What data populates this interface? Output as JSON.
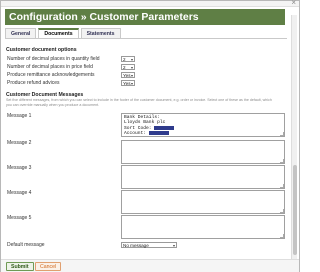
{
  "window": {
    "close_glyph": "×"
  },
  "header": {
    "title": "Configuration » Customer Parameters"
  },
  "tabs": [
    {
      "label": "General"
    },
    {
      "label": "Documents"
    },
    {
      "label": "Statements"
    }
  ],
  "document_options": {
    "title": "Customer document options",
    "rows": [
      {
        "label": "Number of decimal places in quantity field",
        "value": "2"
      },
      {
        "label": "Number of decimal places in price field",
        "value": "2"
      },
      {
        "label": "Produce remittance acknowledgements",
        "value": "Yes"
      },
      {
        "label": "Produce refund advices",
        "value": "Yes"
      }
    ]
  },
  "messages": {
    "title": "Customer Document Messages",
    "help": "Set five different messages, from which you can select to include in the footer of the customer document, e.g. order or invoice. Select one of these as the default, which you can override manually when you produce a document.",
    "items": [
      {
        "label": "Message 1",
        "lines": [
          "Bank Details:",
          "Lloyds Bank plc",
          "Sort Code: ",
          "Account: "
        ]
      },
      {
        "label": "Message 2",
        "lines": []
      },
      {
        "label": "Message 3",
        "lines": []
      },
      {
        "label": "Message 4",
        "lines": []
      },
      {
        "label": "Message 5",
        "lines": []
      }
    ],
    "default_label": "Default message",
    "default_value": "No message"
  },
  "footer": {
    "submit_label": "Submit",
    "cancel_label": "Cancel"
  },
  "colors": {
    "accent": "#5f7f45",
    "redaction": "#2f3b8c",
    "cancel": "#d2691e"
  }
}
